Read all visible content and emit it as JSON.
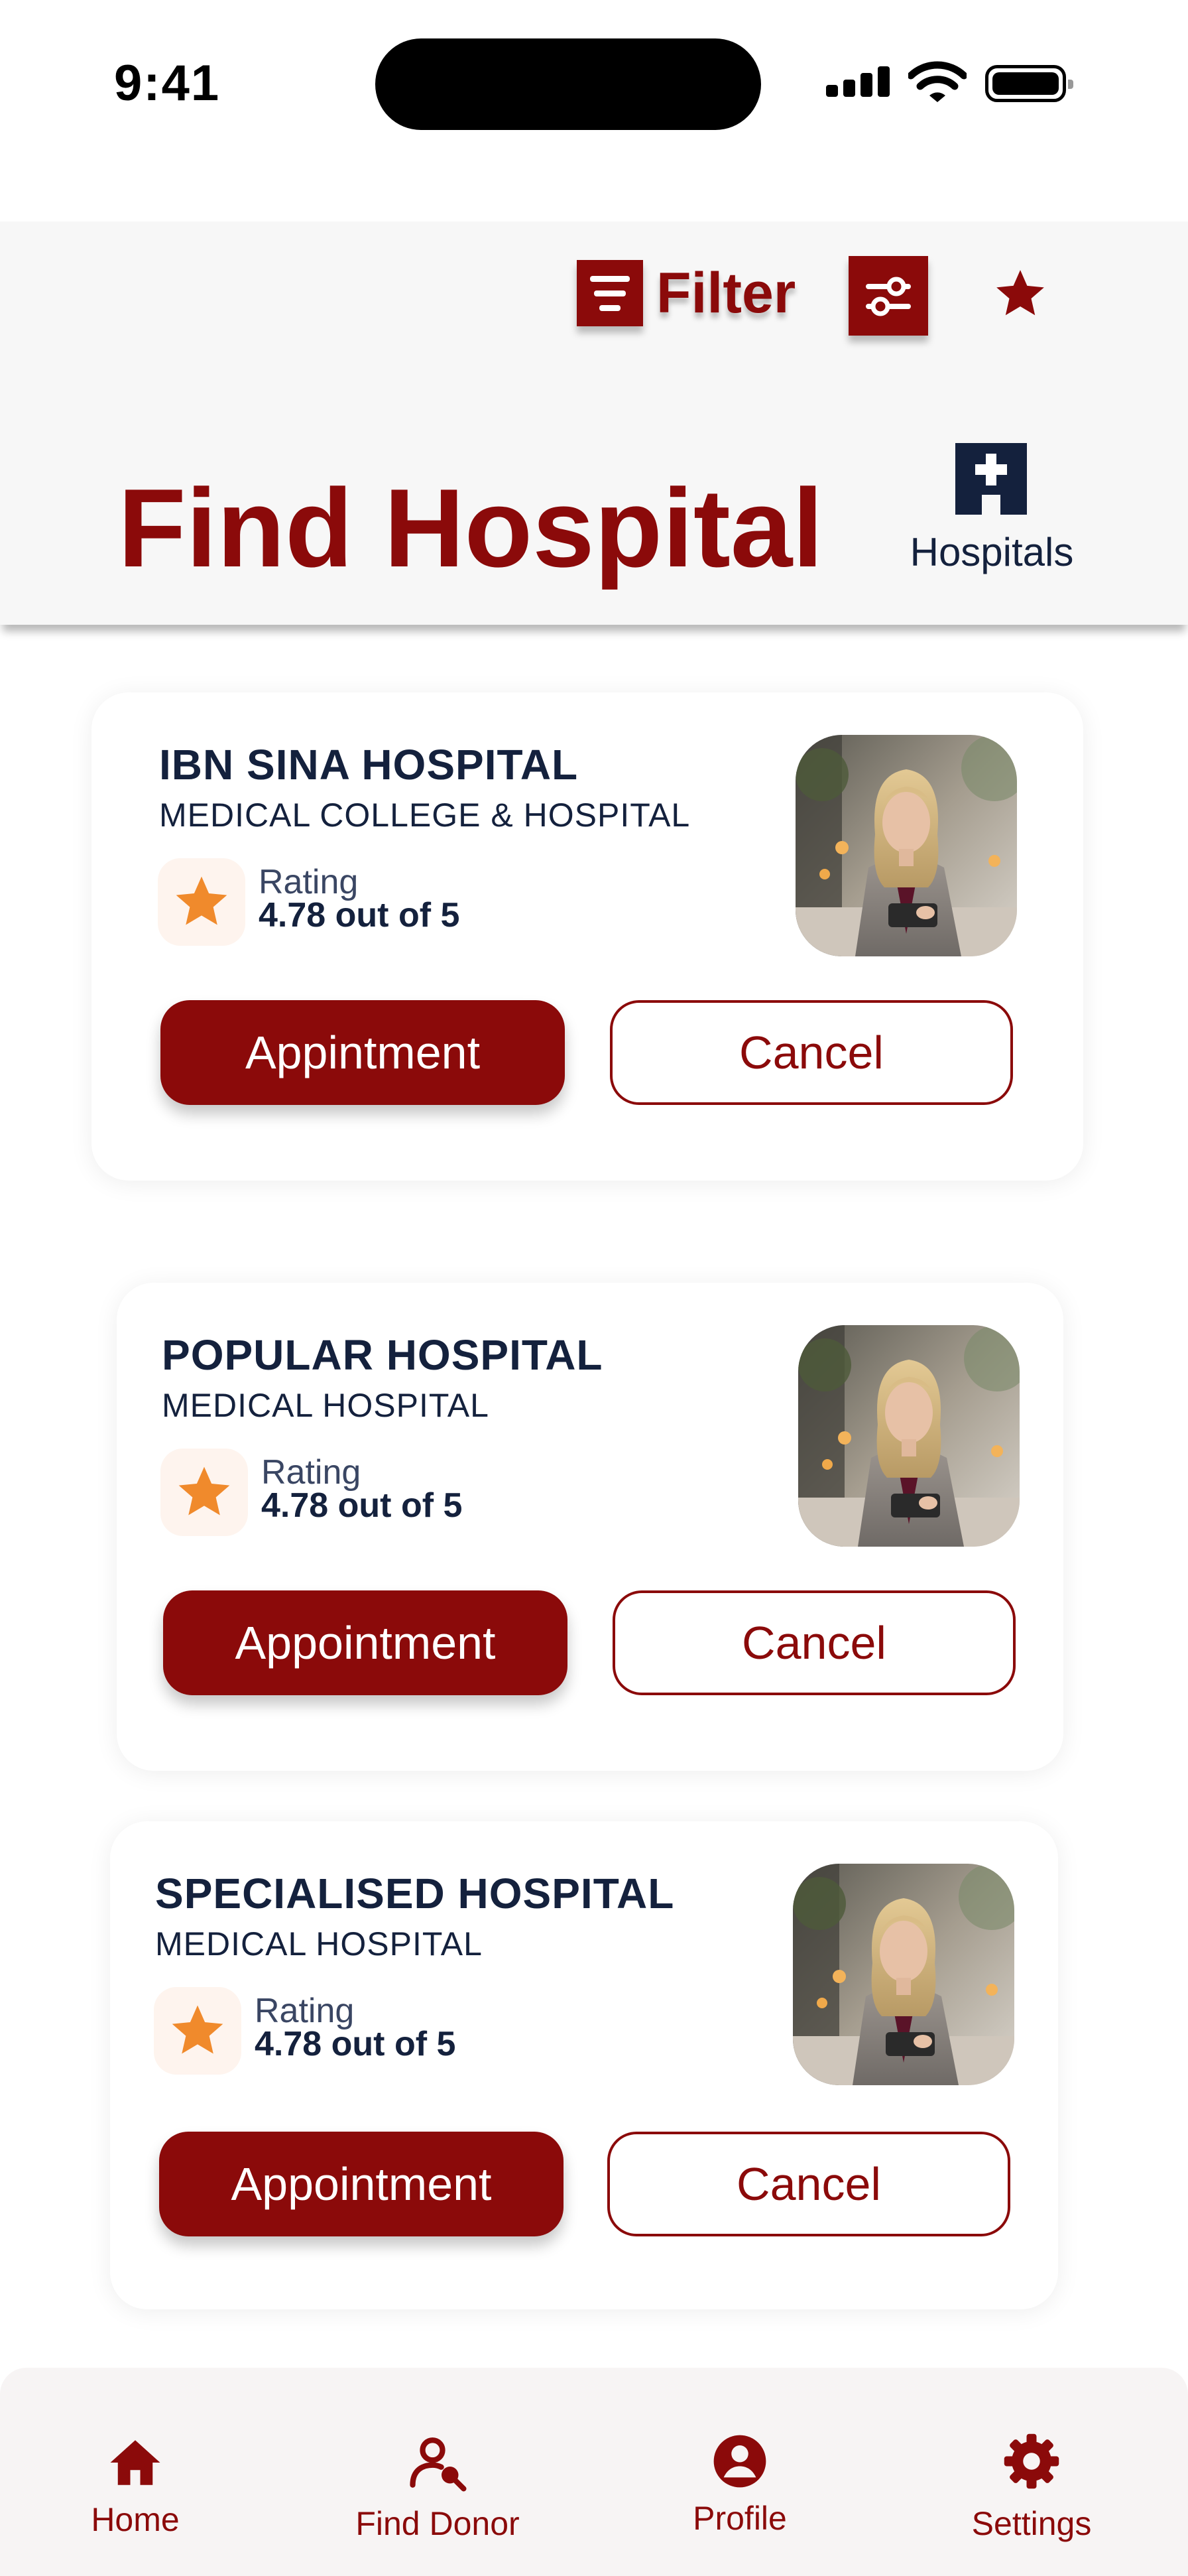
{
  "status_bar": {
    "time": "9:41"
  },
  "header": {
    "filter_label": "Filter",
    "title": "Find Hospital",
    "hospitals_label": "Hospitals"
  },
  "hospitals": [
    {
      "name": "IBN SINA HOSPITAL",
      "subtitle": "MEDICAL COLLEGE & HOSPITAL",
      "rating_label": "Rating",
      "rating_value": "4.78 out of 5",
      "primary_label": "Appintment",
      "secondary_label": "Cancel"
    },
    {
      "name": "POPULAR HOSPITAL",
      "subtitle": "MEDICAL HOSPITAL",
      "rating_label": "Rating",
      "rating_value": "4.78 out of 5",
      "primary_label": "Appointment",
      "secondary_label": "Cancel"
    },
    {
      "name": "SPECIALISED HOSPITAL",
      "subtitle": "MEDICAL HOSPITAL",
      "rating_label": "Rating",
      "rating_value": "4.78 out of 5",
      "primary_label": "Appointment",
      "secondary_label": "Cancel"
    }
  ],
  "nav": {
    "items": [
      {
        "label": "Home",
        "icon": "home-icon"
      },
      {
        "label": "Find Donor",
        "icon": "find-donor-icon"
      },
      {
        "label": "Profile",
        "icon": "profile-icon"
      },
      {
        "label": "Settings",
        "icon": "settings-icon"
      }
    ]
  },
  "colors": {
    "primary": "#8B0A0A",
    "text": "#14213D",
    "rating_star": "#F08A2C",
    "header_bg": "#F7F7F7"
  }
}
